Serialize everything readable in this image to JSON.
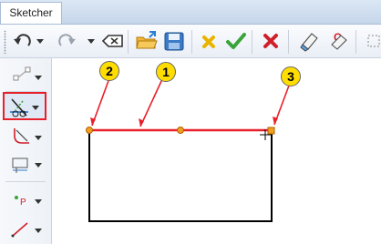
{
  "tabs": [
    {
      "label": "Sketcher"
    }
  ],
  "toolbar": {
    "buttons": [
      {
        "icon": "undo-icon"
      },
      {
        "icon": "redo-icon"
      },
      {
        "icon": "backspace-icon"
      },
      {
        "icon": "open-folder-icon"
      },
      {
        "icon": "save-icon"
      },
      {
        "icon": "cancel-x-icon"
      },
      {
        "icon": "confirm-check-icon"
      },
      {
        "icon": "close-x-icon"
      },
      {
        "icon": "eraser-icon"
      },
      {
        "icon": "constraint-icon"
      }
    ]
  },
  "palette": {
    "items": [
      {
        "icon": "point-select-icon"
      },
      {
        "icon": "trim-line-icon",
        "highlighted": true
      },
      {
        "icon": "fillet-corner-icon"
      },
      {
        "icon": "rectangle-dim-icon"
      },
      {
        "icon": "point-p-icon",
        "label": "P"
      },
      {
        "icon": "line-icon"
      }
    ]
  },
  "callouts": [
    {
      "number": "1"
    },
    {
      "number": "2"
    },
    {
      "number": "3"
    }
  ],
  "colors": {
    "highlight": "#e8202a",
    "callout": "#ffdd00",
    "selected_line": "#e8202a",
    "sketch_line": "#000000",
    "handle": "#f0a020"
  }
}
